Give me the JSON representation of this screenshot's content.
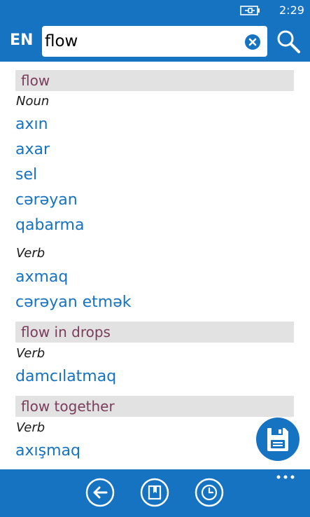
{
  "status_bar": {
    "time": "2:29"
  },
  "header": {
    "language": "EN",
    "query": "flow"
  },
  "entries": [
    {
      "headword": "flow",
      "groups": [
        {
          "pos": "Noun",
          "translations": [
            "axın",
            "axar",
            "sel",
            "cərəyan",
            "qabarma"
          ]
        },
        {
          "pos": "Verb",
          "translations": [
            "axmaq",
            "cərəyan etmək"
          ]
        }
      ]
    },
    {
      "headword": "flow in drops",
      "groups": [
        {
          "pos": "Verb",
          "translations": [
            "damcılatmaq"
          ]
        }
      ]
    },
    {
      "headword": "flow together",
      "groups": [
        {
          "pos": "Verb",
          "translations": [
            "axışmaq"
          ]
        }
      ]
    }
  ],
  "icons": {
    "battery": "battery-charging-icon",
    "clear": "clear-icon",
    "search": "search-icon",
    "save": "save-icon",
    "back": "back-arrow-icon",
    "bookmarks": "bookmarks-icon",
    "history": "history-icon",
    "more": "more-icon"
  },
  "colors": {
    "accent": "#1673c2",
    "headword": "#7a3d5c",
    "headword_bg": "#e2e2e2"
  }
}
